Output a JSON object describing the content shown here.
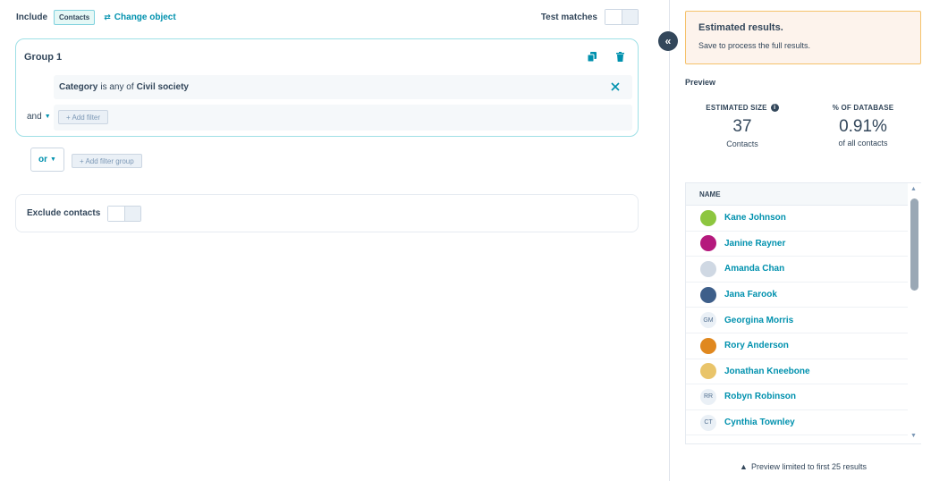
{
  "header": {
    "include_label": "Include",
    "object_tag": "Contacts",
    "change_object_label": "Change object",
    "test_matches_label": "Test matches"
  },
  "group1": {
    "title": "Group 1",
    "filter": {
      "property": "Category",
      "operator": "is any of",
      "value": "Civil society"
    },
    "and_label": "and",
    "add_filter_label": "+ Add filter"
  },
  "or_label": "or",
  "add_filter_group_label": "+ Add filter group",
  "exclude": {
    "label": "Exclude contacts"
  },
  "estimate": {
    "title": "Estimated results.",
    "subtitle": "Save to process the full results."
  },
  "preview": {
    "label": "Preview",
    "size_header": "ESTIMATED SIZE",
    "size_value": "37",
    "size_caption": "Contacts",
    "pct_header": "% OF DATABASE",
    "pct_value": "0.91%",
    "pct_caption": "of all contacts",
    "list_header": "NAME",
    "rows": [
      {
        "name": "Kane Johnson",
        "avatar": "",
        "avatar_color": "#8dc63f"
      },
      {
        "name": "Janine Rayner",
        "avatar": "",
        "avatar_color": "#b5197d"
      },
      {
        "name": "Amanda Chan",
        "avatar": "",
        "avatar_color": "#cfd8e3"
      },
      {
        "name": "Jana Farook",
        "avatar": "",
        "avatar_color": "#3e5f8a"
      },
      {
        "name": "Georgina Morris",
        "avatar": "GM",
        "avatar_color": "#eaf0f6"
      },
      {
        "name": "Rory Anderson",
        "avatar": "",
        "avatar_color": "#e0881f"
      },
      {
        "name": "Jonathan Kneebone",
        "avatar": "",
        "avatar_color": "#e9c46a"
      },
      {
        "name": "Robyn Robinson",
        "avatar": "RR",
        "avatar_color": "#eaf0f6"
      },
      {
        "name": "Cynthia Townley",
        "avatar": "CT",
        "avatar_color": "#eaf0f6"
      }
    ],
    "footer_note": "Preview limited to first 25 results"
  },
  "colors": {
    "accent": "#0091ae",
    "text": "#33475b",
    "warning_bg": "#fdf3ec",
    "warning_border": "#f5c26b"
  }
}
